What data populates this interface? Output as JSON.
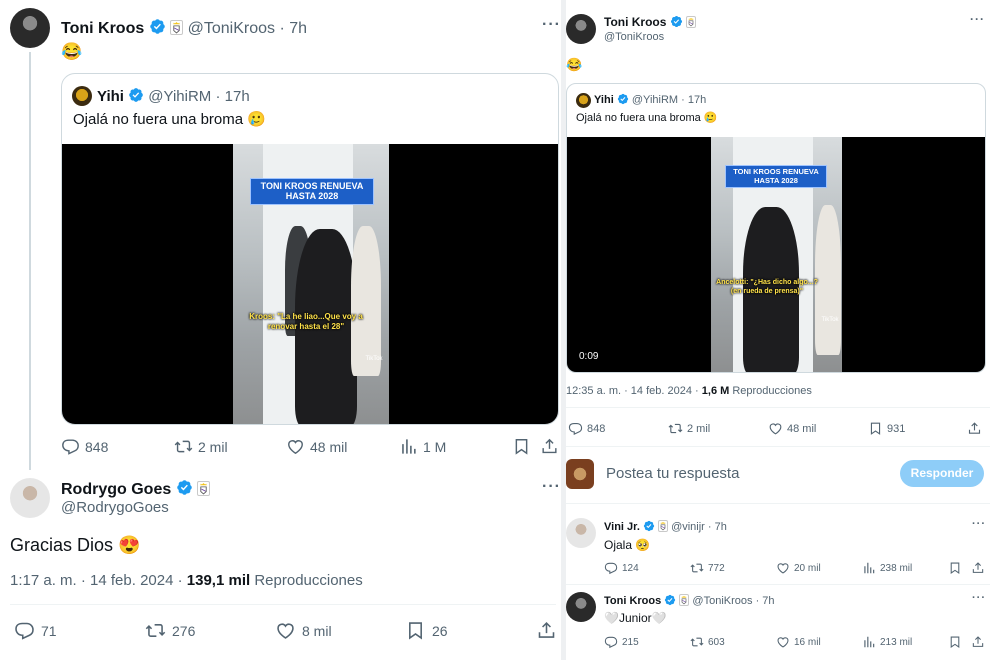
{
  "left": {
    "tweet1": {
      "name": "Toni Kroos",
      "handle": "@ToniKroos",
      "time": "· 7h",
      "text": "😂",
      "quote": {
        "name": "Yihi",
        "handle": "@YihiRM",
        "time": "· 17h",
        "text": "Ojalá no fuera una broma 🥲",
        "video": {
          "banner_line1": "TONI KROOS RENUEVA",
          "banner_line2": "HASTA 2028",
          "caption": "Kroos: \"La he liao...Que voy a renovar hasta el 28\"",
          "watermark": "TikTok"
        }
      },
      "stats": {
        "replies": "848",
        "retweets": "2 mil",
        "likes": "48 mil",
        "views": "1 M"
      }
    },
    "tweet2": {
      "name": "Rodrygo Goes",
      "handle": "@RodrygoGoes",
      "text": "Gracias Dios 😍",
      "meta_time": "1:17 a. m. · 14 feb. 2024 ·",
      "meta_views": "139,1 mil",
      "meta_views_label": "Reproducciones",
      "stats": {
        "replies": "71",
        "retweets": "276",
        "likes": "8 mil",
        "bookmarks": "26"
      }
    }
  },
  "right": {
    "tweet": {
      "name": "Toni Kroos",
      "handle": "@ToniKroos",
      "text": "😂",
      "quote": {
        "name": "Yihi",
        "handle": "@YihiRM",
        "time": "· 17h",
        "text": "Ojalá no fuera una broma 🥲",
        "video": {
          "banner_line1": "TONI KROOS RENUEVA",
          "banner_line2": "HASTA 2028",
          "caption": "Ancelotti: \"¿Has dicho algo...? (en rueda de prensa)\"",
          "watermark": "TikTok",
          "duration": "0:09"
        }
      },
      "meta_time": "12:35 a. m. · 14 feb. 2024 ·",
      "meta_views": "1,6 M",
      "meta_views_label": "Reproducciones",
      "stats": {
        "replies": "848",
        "retweets": "2 mil",
        "likes": "48 mil",
        "bookmarks": "931"
      }
    },
    "composer": {
      "placeholder": "Postea tu respuesta",
      "button": "Responder"
    },
    "replies": [
      {
        "name": "Vini Jr.",
        "handle": "@vinijr",
        "time": "· 7h",
        "text": "Ojala 🥺",
        "stats": {
          "replies": "124",
          "retweets": "772",
          "likes": "20 mil",
          "views": "238 mil"
        }
      },
      {
        "name": "Toni Kroos",
        "handle": "@ToniKroos",
        "time": "· 7h",
        "text": "🤍Junior🤍",
        "stats": {
          "replies": "215",
          "retweets": "603",
          "likes": "16 mil",
          "views": "213 mil"
        }
      }
    ]
  },
  "colors": {
    "accent": "#1d9bf0",
    "muted": "#536471",
    "border": "#cfd9de",
    "reply_button": "#8ecdf8"
  },
  "icons": [
    "verified-badge-icon",
    "real-madrid-crest-icon",
    "more-icon",
    "reply-icon",
    "retweet-icon",
    "like-icon",
    "views-icon",
    "bookmark-icon",
    "share-icon"
  ]
}
